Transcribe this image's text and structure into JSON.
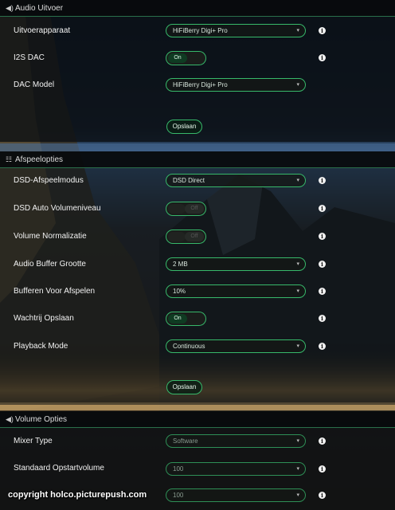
{
  "audio_output": {
    "header": "Audio Uitvoer",
    "header_icon": "speaker-icon",
    "rows": [
      {
        "label": "Uitvoerapparaat",
        "value": "HiFiBerry Digi+ Pro"
      },
      {
        "label": "I2S DAC",
        "toggle": "On"
      },
      {
        "label": "DAC Model",
        "value": "HiFiBerry Digi+ Pro"
      }
    ],
    "save_label": "Opslaan"
  },
  "playback": {
    "header": "Afspeelopties",
    "header_icon": "sliders-icon",
    "rows": [
      {
        "label": "DSD-Afspeelmodus",
        "value": "DSD Direct"
      },
      {
        "label": "DSD Auto Volumeniveau",
        "toggle": "Off"
      },
      {
        "label": "Volume Normalizatie",
        "toggle": "Off"
      },
      {
        "label": "Audio Buffer Grootte",
        "value": "2 MB"
      },
      {
        "label": "Bufferen Voor Afspelen",
        "value": "10%"
      },
      {
        "label": "Wachtrij Opslaan",
        "toggle": "On"
      },
      {
        "label": "Playback Mode",
        "value": "Continuous"
      }
    ],
    "save_label": "Opslaan"
  },
  "volume": {
    "header": "Volume Opties",
    "header_icon": "speaker-icon",
    "rows": [
      {
        "label": "Mixer Type",
        "value": "Software"
      },
      {
        "label": "Standaard Opstartvolume",
        "value": "100"
      },
      {
        "label": "",
        "value": "100"
      }
    ]
  },
  "info_icon": "info-icon",
  "copyright": "copyright holco.picturepush.com",
  "colors": {
    "accent": "#37b86a",
    "panel": "#0a0e12"
  }
}
